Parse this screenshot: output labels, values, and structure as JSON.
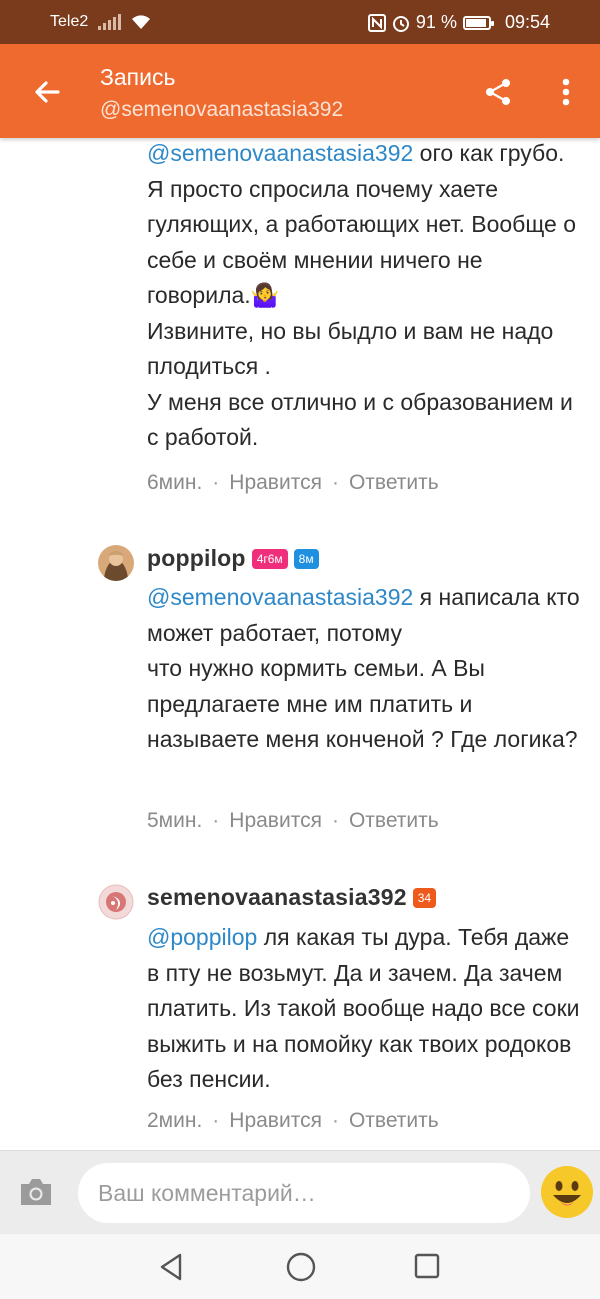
{
  "status_bar": {
    "carrier": "Tele2",
    "battery_percent": "91 %",
    "battery_level": 0.91,
    "time": "09:54",
    "icons": [
      "signal-icon",
      "wifi-icon",
      "nfc-icon",
      "alarm-icon",
      "battery-icon"
    ]
  },
  "app_bar": {
    "title": "Запись",
    "subtitle": "@semenovaanastasia392",
    "background_color": "#ee6a2f",
    "icons": [
      "back-arrow-icon",
      "share-icon",
      "more-vertical-icon"
    ]
  },
  "comments": [
    {
      "mention": "@semenovaanastasia392",
      "text": " ого как грубо. Я просто спросила почему хаете гуляющих, а работающих нет. Вообще о себе и своём мнении ничего не говорила.🤷‍♀️\nИзвините, но вы быдло и вам не надо плодиться .\nУ меня все отлично и с образованием и с работой.",
      "time": "6мин.",
      "like_label": "Нравится",
      "reply_label": "Ответить"
    },
    {
      "username": "poppilop",
      "badges": [
        "4г6м",
        "8м"
      ],
      "mention": "@semenovaanastasia392",
      "text": " я написала кто может работает, потому\nчто нужно кормить семьи. А Вы предлагаете мне им платить и называете меня конченой ? Где логика?",
      "time": "5мин.",
      "like_label": "Нравится",
      "reply_label": "Ответить"
    },
    {
      "username": "semenovaanastasia392",
      "badges": [
        "34"
      ],
      "mention": "@poppilop",
      "text": " ля какая ты дура. Тебя даже в пту не возьмут. Да и зачем. Да зачем платить. Из такой вообще надо все соки выжить и на помойку как твоих родоков без пенсии.",
      "time": "2мин.",
      "like_label": "Нравится",
      "reply_label": "Ответить"
    }
  ],
  "composer": {
    "placeholder": "Ваш комментарий…",
    "icons": [
      "camera-icon",
      "emoji-icon"
    ]
  },
  "nav_bar": {
    "icons": [
      "nav-back-icon",
      "nav-home-icon",
      "nav-recent-apps-icon"
    ]
  }
}
